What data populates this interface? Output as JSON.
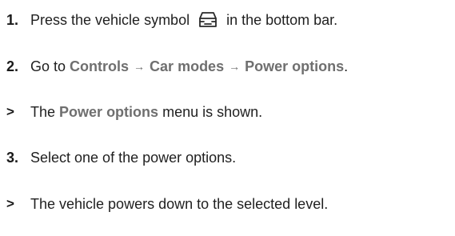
{
  "steps": [
    {
      "marker": "1.",
      "before": "Press the vehicle symbol",
      "icon": "car-icon",
      "after": "in the bottom bar."
    },
    {
      "marker": "2.",
      "before": "Go to",
      "path": [
        "Controls",
        "Car modes",
        "Power options"
      ],
      "arrow": "→",
      "after": "."
    },
    {
      "marker": ">",
      "term": "Power options",
      "after": "menu is shown.",
      "before": "The"
    },
    {
      "marker": "3.",
      "text": "Select one of the power options."
    },
    {
      "marker": ">",
      "text": "The vehicle powers down to the selected level."
    }
  ]
}
